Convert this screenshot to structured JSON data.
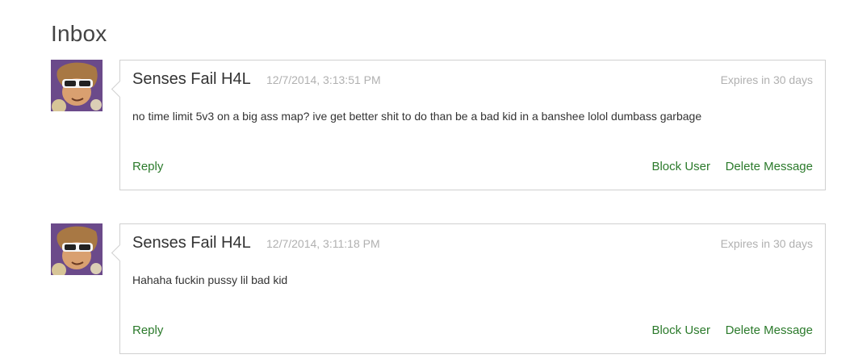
{
  "page": {
    "title": "Inbox"
  },
  "messages": [
    {
      "sender": "Senses Fail H4L",
      "timestamp": "12/7/2014, 3:13:51 PM",
      "expires": "Expires in 30 days",
      "body": "no time limit 5v3 on a big ass map? ive get better shit to do than be a bad kid in a banshee lolol dumbass garbage",
      "reply_label": "Reply",
      "block_label": "Block User",
      "delete_label": "Delete Message"
    },
    {
      "sender": "Senses Fail H4L",
      "timestamp": "12/7/2014, 3:11:18 PM",
      "expires": "Expires in 30 days",
      "body": "Hahaha fuckin pussy lil bad kid",
      "reply_label": "Reply",
      "block_label": "Block User",
      "delete_label": "Delete Message"
    }
  ],
  "colors": {
    "action_green": "#2b7a2b",
    "muted_gray": "#b0b0b0",
    "border_gray": "#d0d0d0"
  }
}
